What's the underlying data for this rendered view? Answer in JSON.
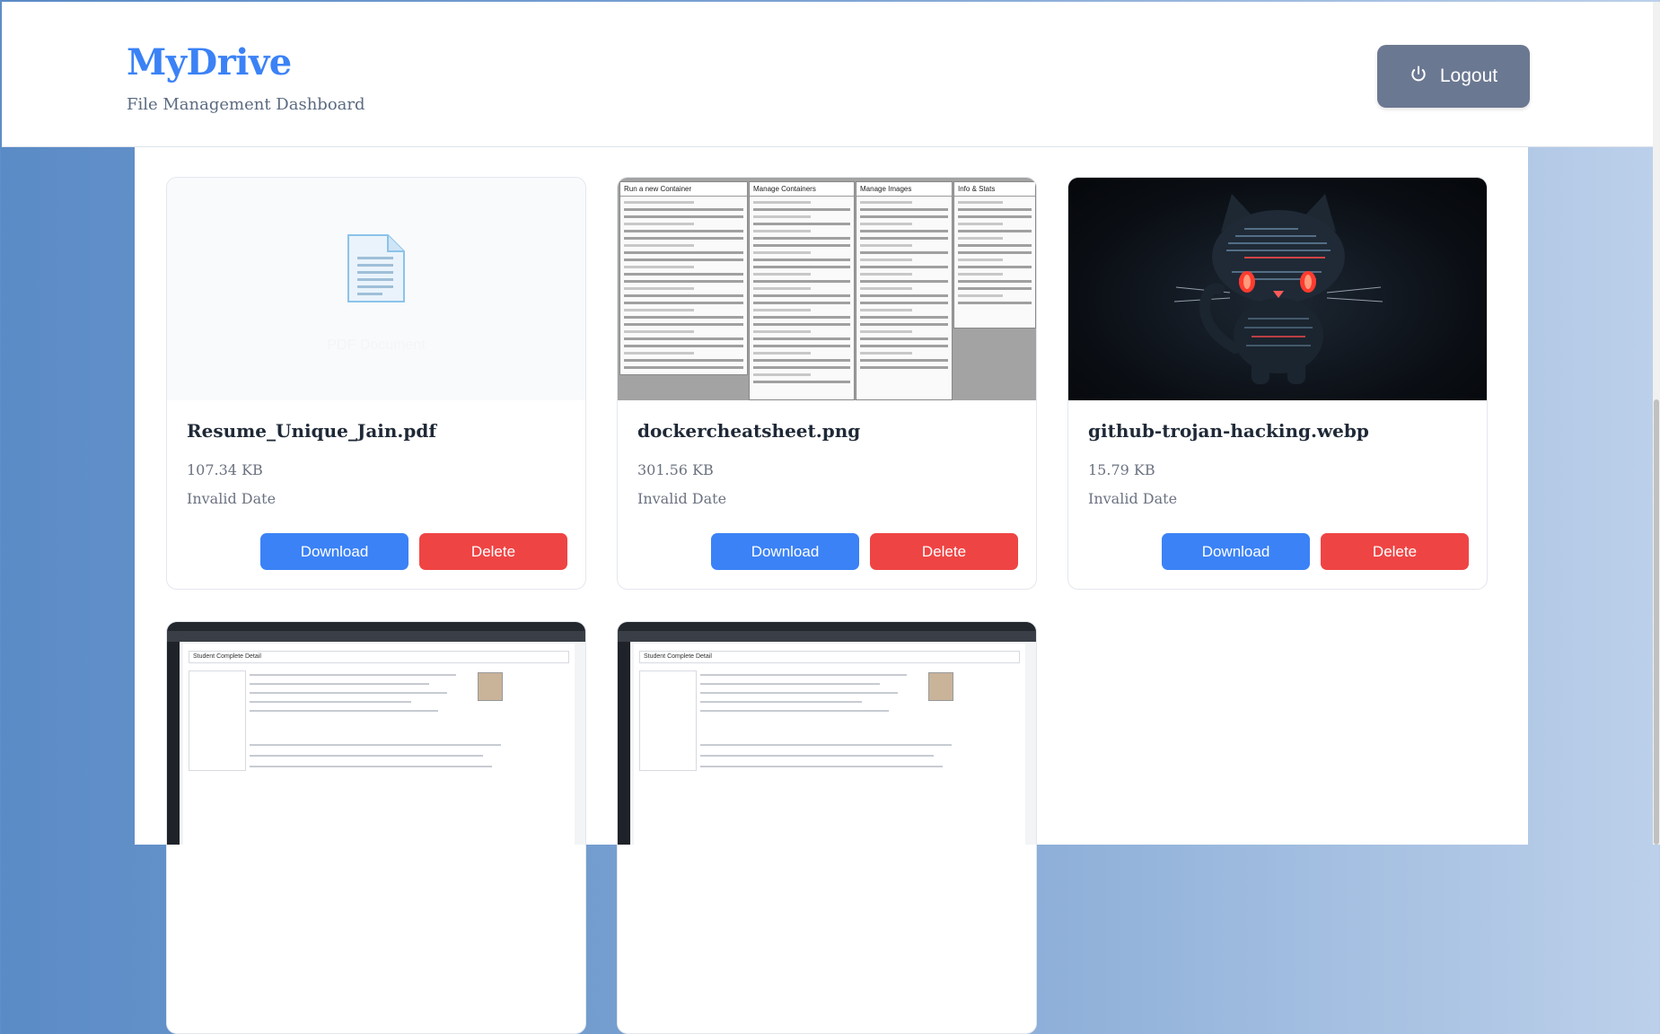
{
  "header": {
    "title": "MyDrive",
    "subtitle": "File Management Dashboard",
    "logout_label": "Logout",
    "logout_icon": "power-icon"
  },
  "colors": {
    "brand": "#3b82f6",
    "download": "#3b82f6",
    "delete": "#ef4444",
    "logout": "#6b7891"
  },
  "files": [
    {
      "name": "Resume_Unique_Jain.pdf",
      "size": "107.34 KB",
      "date": "Invalid Date",
      "preview_type": "pdf",
      "preview_label": "PDF Document",
      "download_label": "Download",
      "delete_label": "Delete"
    },
    {
      "name": "dockercheatsheet.png",
      "size": "301.56 KB",
      "date": "Invalid Date",
      "preview_type": "image",
      "preview_headers": [
        "Run a new Container",
        "Manage Containers",
        "Manage Images",
        "Info & Stats"
      ],
      "download_label": "Download",
      "delete_label": "Delete"
    },
    {
      "name": "github-trojan-hacking.webp",
      "size": "15.79 KB",
      "date": "Invalid Date",
      "preview_type": "image",
      "download_label": "Download",
      "delete_label": "Delete"
    },
    {
      "preview_type": "image",
      "preview_heading": "Student Complete Detail"
    },
    {
      "preview_type": "image",
      "preview_heading": "Student Complete Detail"
    }
  ]
}
